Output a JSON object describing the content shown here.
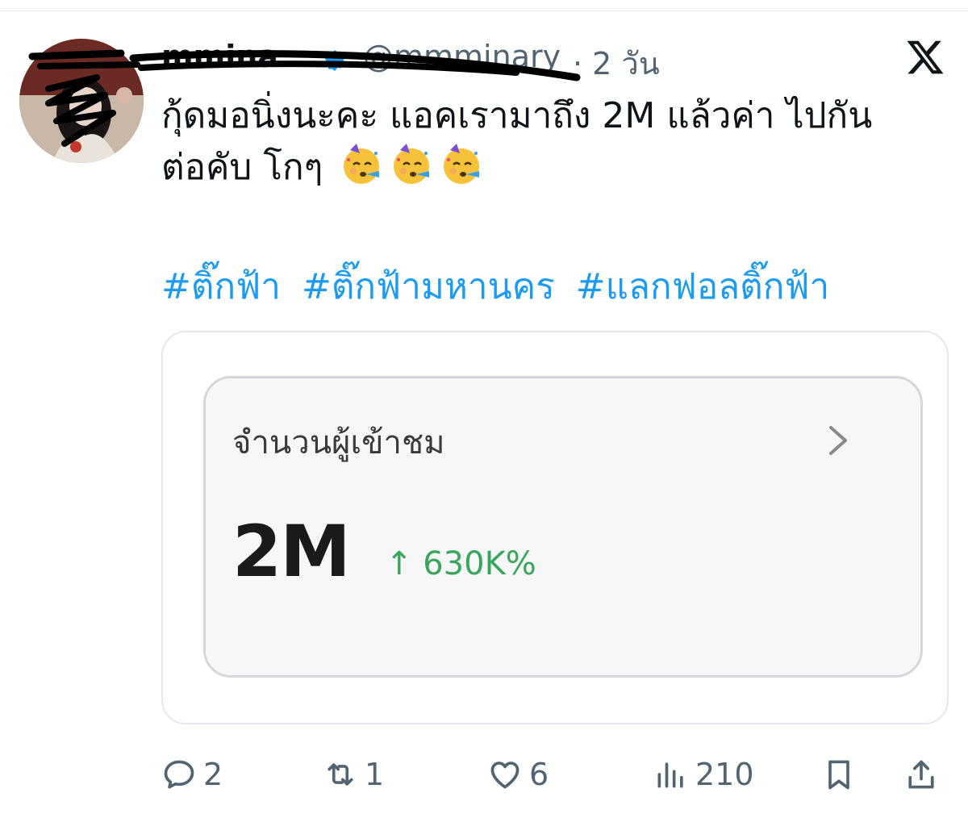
{
  "tweet": {
    "author_name": "mmina",
    "handle": "@mmminary",
    "timestamp": "· 2 วัน",
    "text_line1": "กุ้ดมอนิ่งนะคะ แอคเรามาถึง 2M แล้วค่า ไปกัน",
    "text_line2": "ต่อคับ โกๆ",
    "emoji": [
      "partying-face",
      "partying-face",
      "partying-face"
    ],
    "hashtags": [
      "#ติ๊กฟ้า",
      "#ติ๊กฟ้ามหานคร",
      "#แลกฟอลติ๊กฟ้า"
    ]
  },
  "media": {
    "stat_label": "จำนวนผู้เข้าชม",
    "stat_value": "2M",
    "stat_change": "↑ 630K%"
  },
  "actions": {
    "replies": "2",
    "reposts": "1",
    "likes": "6",
    "views": "210"
  },
  "colors": {
    "link": "#1d9bf0",
    "muted": "#536471",
    "positive": "#3aa55d"
  }
}
